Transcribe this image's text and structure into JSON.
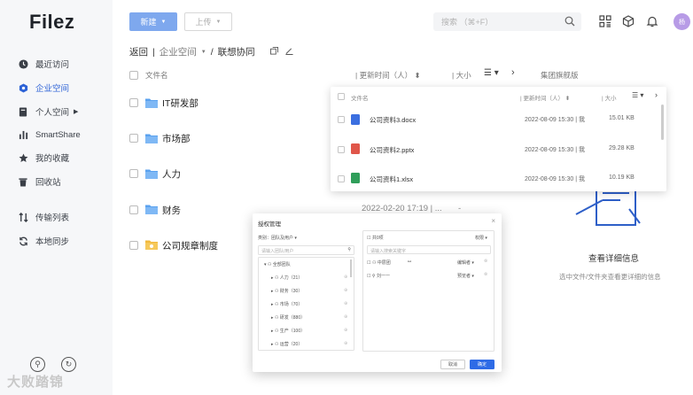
{
  "app": {
    "logo": "Filez",
    "avatar_text": "杨"
  },
  "sidebar": {
    "items": [
      {
        "label": "最近访问",
        "icon": "clock-icon"
      },
      {
        "label": "企业空间",
        "icon": "enterprise-icon"
      },
      {
        "label": "个人空间",
        "icon": "personal-space-icon"
      },
      {
        "label": "SmartShare",
        "icon": "bar-chart-icon"
      },
      {
        "label": "我的收藏",
        "icon": "star-icon"
      },
      {
        "label": "回收站",
        "icon": "trash-icon"
      },
      {
        "label": "传输列表",
        "icon": "transfer-icon"
      },
      {
        "label": "本地同步",
        "icon": "sync-icon"
      }
    ],
    "watermark": "大败踏锦"
  },
  "toolbar": {
    "new_label": "新建",
    "upload_label": "上传",
    "search_placeholder": "搜索  （⌘+F）"
  },
  "breadcrumb": {
    "back": "返回",
    "space": "企业空间",
    "current": "联想协同"
  },
  "columns": {
    "name": "文件名",
    "time": "更新时间（人）",
    "size": "大小",
    "extra": "集团旗舰版"
  },
  "files": [
    {
      "name": "IT研发部",
      "time": ""
    },
    {
      "name": "市场部",
      "time": ""
    },
    {
      "name": "人力",
      "time": ""
    },
    {
      "name": "财务",
      "time": "2022-02-20 17:19 | ..."
    },
    {
      "name": "公司规章制度",
      "time": ""
    }
  ],
  "popup": {
    "col_name": "文件名",
    "col_time": "更新时间（人）",
    "col_size": "大小",
    "rows": [
      {
        "name": "公司资料3.docx",
        "time": "2022-08-09 15:30 | 我",
        "size": "15.01 KB",
        "color": "#3b6fe0"
      },
      {
        "name": "公司资料2.pptx",
        "time": "2022-08-09 15:30 | 我",
        "size": "29.28 KB",
        "color": "#e0564a"
      },
      {
        "name": "公司资料1.xlsx",
        "time": "2022-08-09 15:30 | 我",
        "size": "10.19 KB",
        "color": "#2f9e5a"
      }
    ]
  },
  "detail": {
    "title": "查看详细信息",
    "subtitle": "选中文件/文件夹查看更详细的信息"
  },
  "dialog": {
    "title": "授权管理",
    "left_label": "类别：",
    "left_select": "团队及用户",
    "search_placeholder": "请输入团队/用户",
    "tree_root": "全部团队",
    "tree_items": [
      "人力（21）",
      "财务（30）",
      "市场（70）",
      "研发（880）",
      "生产（100）",
      "运营（20）"
    ],
    "right_label": "共0项",
    "right_perm": "权限",
    "right_search": "请输入搜索关键字",
    "right_rows": [
      {
        "name": "中层团",
        "perm": "编辑者"
      },
      {
        "name": "刘一一",
        "perm": "预览者"
      }
    ],
    "cancel": "取消",
    "confirm": "确定"
  }
}
